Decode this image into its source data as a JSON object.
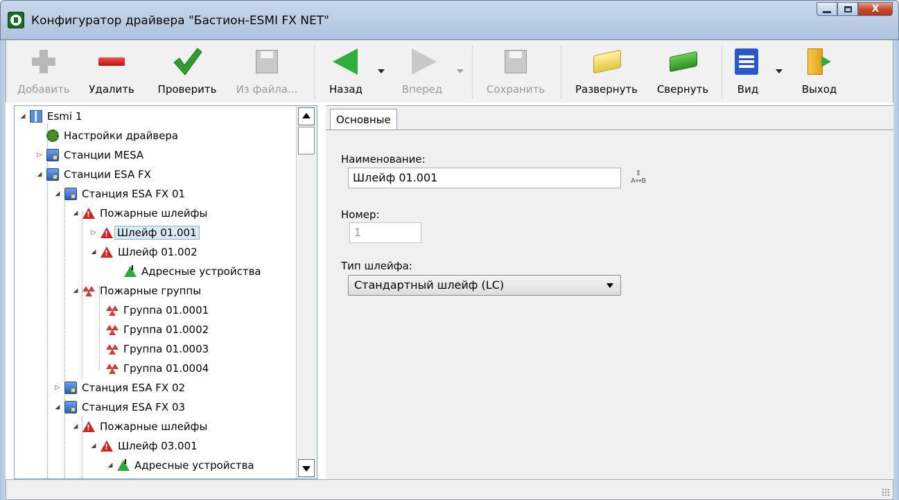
{
  "window": {
    "title": "Конфигуратор драйвера \"Бастион-ESMI FX NET\"",
    "close_label": "X"
  },
  "toolbar": {
    "add_label": "Добавить",
    "delete_label": "Удалить",
    "check_label": "Проверить",
    "from_file_label": "Из файла...",
    "back_label": "Назад",
    "forward_label": "Вперед",
    "save_label": "Сохранить",
    "expand_label": "Развернуть",
    "collapse_label": "Свернуть",
    "view_label": "Вид",
    "exit_label": "Выход"
  },
  "tree": {
    "items": [
      {
        "label": "Esmi 1"
      },
      {
        "label": "Настройки драйвера"
      },
      {
        "label": "Станции MESA"
      },
      {
        "label": "Станции ESA FX"
      },
      {
        "label": "Станция ESA FX 01"
      },
      {
        "label": "Пожарные шлейфы"
      },
      {
        "label": "Шлейф 01.001"
      },
      {
        "label": "Шлейф 01.002"
      },
      {
        "label": "Адресные устройства"
      },
      {
        "label": "Пожарные группы"
      },
      {
        "label": "Группа 01.0001"
      },
      {
        "label": "Группа 01.0002"
      },
      {
        "label": "Группа 01.0003"
      },
      {
        "label": "Группа 01.0004"
      },
      {
        "label": "Станция ESA FX 02"
      },
      {
        "label": "Станция ESA FX 03"
      },
      {
        "label": "Пожарные шлейфы"
      },
      {
        "label": "Шлейф 03.001"
      },
      {
        "label": "Адресные устройства"
      }
    ]
  },
  "details": {
    "tab_label": "Основные",
    "name_label": "Наименование:",
    "name_value": "Шлейф 01.001",
    "number_label": "Номер:",
    "number_value": "1",
    "type_label": "Тип шлейфа:",
    "type_value": "Стандартный шлейф (LC)"
  }
}
